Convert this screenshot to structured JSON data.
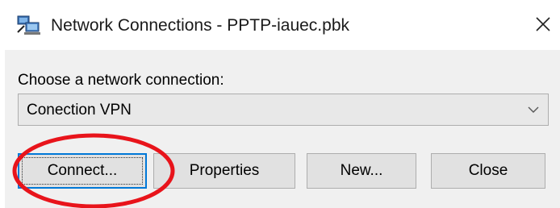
{
  "window": {
    "title": "Network Connections - PPTP-iauec.pbk",
    "app_icon": "network-connections-icon",
    "close_icon": "close-icon"
  },
  "dialog": {
    "prompt": "Choose a network connection:",
    "connection_select": {
      "selected": "Conection VPN",
      "arrow_icon": "chevron-down-icon"
    },
    "buttons": {
      "connect": "Connect...",
      "properties": "Properties",
      "new": "New...",
      "close": "Close"
    }
  },
  "annotation": {
    "shape": "ellipse",
    "color": "#e8141b",
    "target": "connect-button"
  }
}
